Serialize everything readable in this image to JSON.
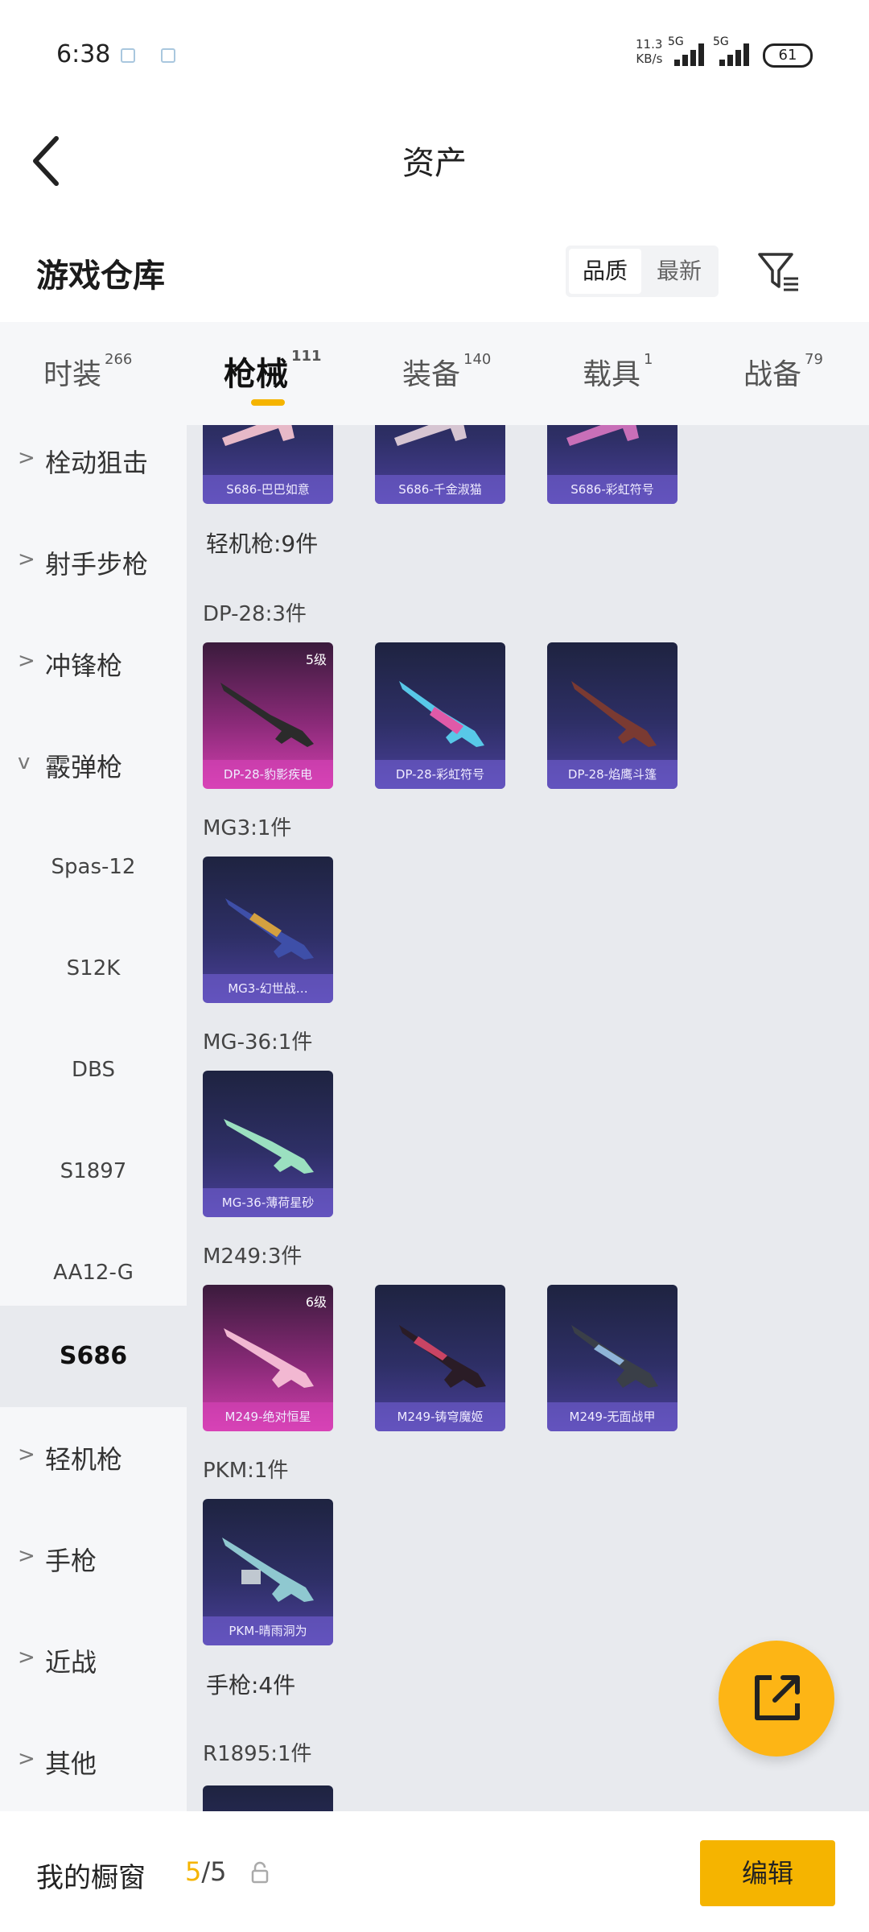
{
  "status_bar": {
    "time": "6:38",
    "net_speed_value": "11.3",
    "net_speed_unit": "KB/s",
    "sim1": "5G",
    "sim2": "5G",
    "battery": "61"
  },
  "header": {
    "title": "资产"
  },
  "warehouse": {
    "title": "游戏仓库",
    "sort_options": [
      "品质",
      "最新"
    ],
    "active_sort": "品质"
  },
  "tabs": [
    {
      "label": "时装",
      "count": "266"
    },
    {
      "label": "枪械",
      "count": "111",
      "active": true
    },
    {
      "label": "装备",
      "count": "140"
    },
    {
      "label": "载具",
      "count": "1"
    },
    {
      "label": "战备",
      "count": "79"
    }
  ],
  "sidebar": {
    "items": [
      {
        "label": "栓动狙击",
        "chevron": ">"
      },
      {
        "label": "射手步枪",
        "chevron": ">"
      },
      {
        "label": "冲锋枪",
        "chevron": ">"
      },
      {
        "label": "霰弹枪",
        "chevron": "v"
      }
    ],
    "sub_items": [
      "Spas-12",
      "S12K",
      "DBS",
      "S1897",
      "AA12-G",
      "S686"
    ],
    "selected_sub": "S686",
    "items_after": [
      {
        "label": "轻机枪",
        "chevron": ">"
      },
      {
        "label": "手枪",
        "chevron": ">"
      },
      {
        "label": "近战",
        "chevron": ">"
      },
      {
        "label": "其他",
        "chevron": ">"
      }
    ]
  },
  "main": {
    "top_cards": [
      {
        "name": "S686-巴巴如意"
      },
      {
        "name": "S686-千金淑猫"
      },
      {
        "name": "S686-彩虹符号"
      }
    ],
    "section_lmg": "轻机枪:9件",
    "groups": [
      {
        "label": "DP-28:3件",
        "cards": [
          {
            "name": "DP-28-豹影疾电",
            "badge": "5级",
            "rarity": "pink"
          },
          {
            "name": "DP-28-彩虹符号",
            "rarity": "purple"
          },
          {
            "name": "DP-28-焰鹰斗篷",
            "rarity": "purple"
          }
        ]
      },
      {
        "label": "MG3:1件",
        "cards": [
          {
            "name": "MG3-幻世战…",
            "rarity": "purple"
          }
        ]
      },
      {
        "label": "MG-36:1件",
        "cards": [
          {
            "name": "MG-36-薄荷星砂",
            "rarity": "purple"
          }
        ]
      },
      {
        "label": "M249:3件",
        "cards": [
          {
            "name": "M249-绝对恒星",
            "badge": "6级",
            "rarity": "pink"
          },
          {
            "name": "M249-铸穹魔姬",
            "rarity": "purple"
          },
          {
            "name": "M249-无面战甲",
            "rarity": "purple"
          }
        ]
      },
      {
        "label": "PKM:1件",
        "cards": [
          {
            "name": "PKM-晴雨洞为",
            "rarity": "purple"
          }
        ]
      }
    ],
    "section_pistol": "手枪:4件",
    "r1895_label": "R1895:1件"
  },
  "bottom_bar": {
    "showcase_label": "我的橱窗",
    "count_current": "5",
    "count_total": "/5",
    "edit_label": "编辑"
  },
  "colors": {
    "accent": "#f5b400",
    "fab": "#fdb515",
    "panel_bg": "#e8eaee",
    "sidebar_bg": "#f6f7f9"
  }
}
